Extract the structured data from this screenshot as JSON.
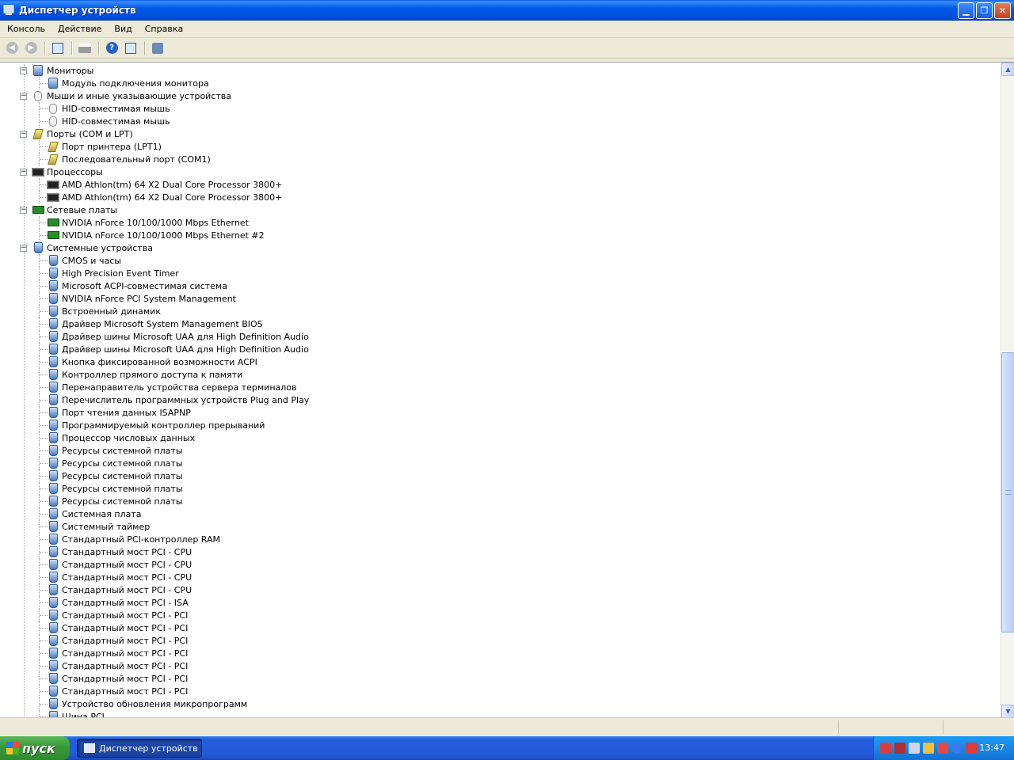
{
  "window": {
    "title": "Диспетчер устройств"
  },
  "menu": [
    "Консоль",
    "Действие",
    "Вид",
    "Справка"
  ],
  "tree": [
    {
      "label": "Мониторы",
      "level": 0,
      "icon": "monitor-icon",
      "expanded": true
    },
    {
      "label": "Модуль подключения монитора",
      "level": 1,
      "icon": "monitor-icon"
    },
    {
      "label": "Мыши и иные указывающие устройства",
      "level": 0,
      "icon": "mouse-icon",
      "expanded": true
    },
    {
      "label": "HID-совместимая мышь",
      "level": 1,
      "icon": "mouse-icon"
    },
    {
      "label": "HID-совместимая мышь",
      "level": 1,
      "icon": "mouse-icon"
    },
    {
      "label": "Порты (COM и LPT)",
      "level": 0,
      "icon": "port-icon",
      "expanded": true
    },
    {
      "label": "Порт принтера (LPT1)",
      "level": 1,
      "icon": "port-icon"
    },
    {
      "label": "Последовательный порт (COM1)",
      "level": 1,
      "icon": "port-icon"
    },
    {
      "label": "Процессоры",
      "level": 0,
      "icon": "cpu-icon",
      "expanded": true
    },
    {
      "label": "AMD Athlon(tm) 64 X2 Dual Core Processor 3800+",
      "level": 1,
      "icon": "cpu-icon"
    },
    {
      "label": "AMD Athlon(tm) 64 X2 Dual Core Processor 3800+",
      "level": 1,
      "icon": "cpu-icon"
    },
    {
      "label": "Сетевые платы",
      "level": 0,
      "icon": "network-card-icon",
      "expanded": true
    },
    {
      "label": "NVIDIA nForce 10/100/1000 Mbps Ethernet",
      "level": 1,
      "icon": "network-card-icon"
    },
    {
      "label": "NVIDIA nForce 10/100/1000 Mbps Ethernet #2",
      "level": 1,
      "icon": "network-card-icon"
    },
    {
      "label": "Системные устройства",
      "level": 0,
      "icon": "system-device-icon",
      "expanded": true
    },
    {
      "label": "CMOS и часы",
      "level": 1,
      "icon": "system-device-icon"
    },
    {
      "label": "High Precision Event Timer",
      "level": 1,
      "icon": "system-device-icon"
    },
    {
      "label": "Microsoft ACPI-совместимая система",
      "level": 1,
      "icon": "system-device-icon"
    },
    {
      "label": "NVIDIA nForce PCI System Management",
      "level": 1,
      "icon": "system-device-icon"
    },
    {
      "label": "Встроенный динамик",
      "level": 1,
      "icon": "system-device-icon"
    },
    {
      "label": "Драйвер Microsoft System Management BIOS",
      "level": 1,
      "icon": "system-device-icon"
    },
    {
      "label": "Драйвер шины Microsoft UAA для High Definition Audio",
      "level": 1,
      "icon": "system-device-icon"
    },
    {
      "label": "Драйвер шины Microsoft UAA для High Definition Audio",
      "level": 1,
      "icon": "system-device-icon"
    },
    {
      "label": "Кнопка фиксированной возможности ACPI",
      "level": 1,
      "icon": "system-device-icon"
    },
    {
      "label": "Контроллер прямого доступа к памяти",
      "level": 1,
      "icon": "system-device-icon"
    },
    {
      "label": "Перенаправитель устройства сервера терминалов",
      "level": 1,
      "icon": "system-device-icon"
    },
    {
      "label": "Перечислитель программных устройств Plug and Play",
      "level": 1,
      "icon": "system-device-icon"
    },
    {
      "label": "Порт чтения данных ISAPNP",
      "level": 1,
      "icon": "system-device-icon"
    },
    {
      "label": "Программируемый контроллер прерываний",
      "level": 1,
      "icon": "system-device-icon"
    },
    {
      "label": "Процессор числовых данных",
      "level": 1,
      "icon": "system-device-icon"
    },
    {
      "label": "Ресурсы системной платы",
      "level": 1,
      "icon": "system-device-icon"
    },
    {
      "label": "Ресурсы системной платы",
      "level": 1,
      "icon": "system-device-icon"
    },
    {
      "label": "Ресурсы системной платы",
      "level": 1,
      "icon": "system-device-icon"
    },
    {
      "label": "Ресурсы системной платы",
      "level": 1,
      "icon": "system-device-icon"
    },
    {
      "label": "Ресурсы системной платы",
      "level": 1,
      "icon": "system-device-icon"
    },
    {
      "label": "Системная плата",
      "level": 1,
      "icon": "system-device-icon"
    },
    {
      "label": "Системный таймер",
      "level": 1,
      "icon": "system-device-icon"
    },
    {
      "label": "Стандартный PCI-контроллер RAM",
      "level": 1,
      "icon": "system-device-icon"
    },
    {
      "label": "Стандартный мост PCI  - CPU",
      "level": 1,
      "icon": "system-device-icon"
    },
    {
      "label": "Стандартный мост PCI  - CPU",
      "level": 1,
      "icon": "system-device-icon"
    },
    {
      "label": "Стандартный мост PCI  - CPU",
      "level": 1,
      "icon": "system-device-icon"
    },
    {
      "label": "Стандартный мост PCI  - CPU",
      "level": 1,
      "icon": "system-device-icon"
    },
    {
      "label": "Стандартный мост PCI - ISA",
      "level": 1,
      "icon": "system-device-icon"
    },
    {
      "label": "Стандартный мост PCI - PCI",
      "level": 1,
      "icon": "system-device-icon"
    },
    {
      "label": "Стандартный мост PCI - PCI",
      "level": 1,
      "icon": "system-device-icon"
    },
    {
      "label": "Стандартный мост PCI - PCI",
      "level": 1,
      "icon": "system-device-icon"
    },
    {
      "label": "Стандартный мост PCI - PCI",
      "level": 1,
      "icon": "system-device-icon"
    },
    {
      "label": "Стандартный мост PCI - PCI",
      "level": 1,
      "icon": "system-device-icon"
    },
    {
      "label": "Стандартный мост PCI - PCI",
      "level": 1,
      "icon": "system-device-icon"
    },
    {
      "label": "Стандартный мост PCI - PCI",
      "level": 1,
      "icon": "system-device-icon"
    },
    {
      "label": "Устройство обновления микропрограмм",
      "level": 1,
      "icon": "system-device-icon"
    },
    {
      "label": "Шина PCI",
      "level": 1,
      "icon": "system-device-icon"
    }
  ],
  "taskbar": {
    "start_label": "пуск",
    "task_label": "Диспетчер устройств",
    "clock": "13:47"
  },
  "colors": {
    "titlebar": "#0058e6",
    "taskbar": "#245edc",
    "start": "#3a9a3a"
  }
}
